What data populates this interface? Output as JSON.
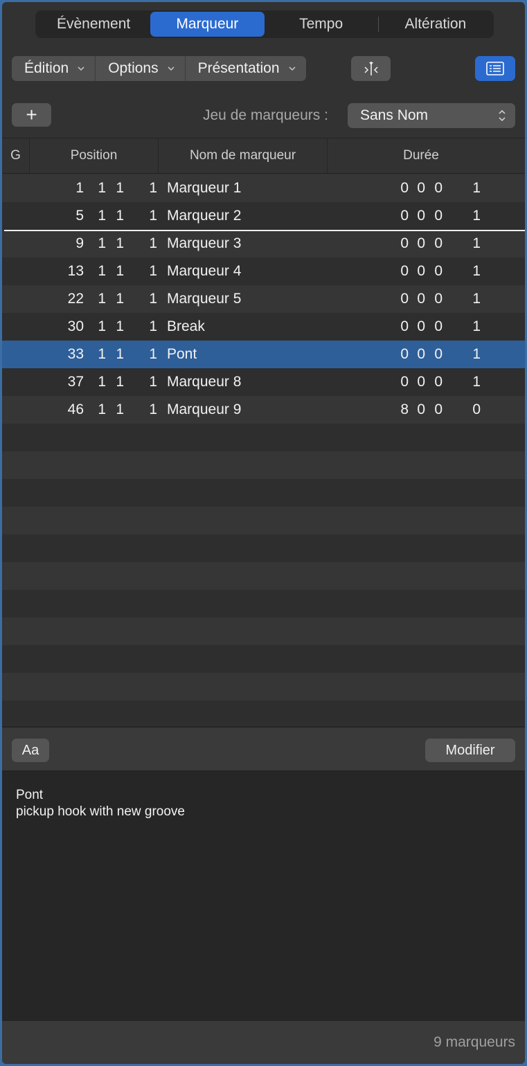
{
  "tabs": [
    {
      "label": "Évènement",
      "active": false
    },
    {
      "label": "Marqueur",
      "active": true
    },
    {
      "label": "Tempo",
      "active": false
    },
    {
      "label": "Altération",
      "active": false
    }
  ],
  "toolbar": {
    "menus": [
      "Édition",
      "Options",
      "Présentation"
    ],
    "snap_icon": "marker-snap-icon",
    "list_icon": "list-view-icon"
  },
  "add_button": "+",
  "marker_set": {
    "label": "Jeu de marqueurs :",
    "value": "Sans Nom"
  },
  "columns": {
    "g": "G",
    "position": "Position",
    "name": "Nom de marqueur",
    "duration": "Durée"
  },
  "markers": [
    {
      "pos": [
        "1",
        "1",
        "1",
        "1"
      ],
      "name": "Marqueur 1",
      "dur": [
        "0",
        "0",
        "0",
        "1"
      ]
    },
    {
      "pos": [
        "5",
        "1",
        "1",
        "1"
      ],
      "name": "Marqueur 2",
      "dur": [
        "0",
        "0",
        "0",
        "1"
      ]
    },
    {
      "pos": [
        "9",
        "1",
        "1",
        "1"
      ],
      "name": "Marqueur 3",
      "dur": [
        "0",
        "0",
        "0",
        "1"
      ]
    },
    {
      "pos": [
        "13",
        "1",
        "1",
        "1"
      ],
      "name": "Marqueur 4",
      "dur": [
        "0",
        "0",
        "0",
        "1"
      ]
    },
    {
      "pos": [
        "22",
        "1",
        "1",
        "1"
      ],
      "name": "Marqueur 5",
      "dur": [
        "0",
        "0",
        "0",
        "1"
      ]
    },
    {
      "pos": [
        "30",
        "1",
        "1",
        "1"
      ],
      "name": "Break",
      "dur": [
        "0",
        "0",
        "0",
        "1"
      ]
    },
    {
      "pos": [
        "33",
        "1",
        "1",
        "1"
      ],
      "name": "Pont",
      "dur": [
        "0",
        "0",
        "0",
        "1"
      ],
      "selected": true
    },
    {
      "pos": [
        "37",
        "1",
        "1",
        "1"
      ],
      "name": "Marqueur 8",
      "dur": [
        "0",
        "0",
        "0",
        "1"
      ]
    },
    {
      "pos": [
        "46",
        "1",
        "1",
        "1"
      ],
      "name": "Marqueur 9",
      "dur": [
        "8",
        "0",
        "0",
        "0"
      ]
    }
  ],
  "font_button": "Aa",
  "modify_button": "Modifier",
  "notes": {
    "line1": "Pont",
    "line2": "pickup hook with new groove"
  },
  "status": "9 marqueurs",
  "colors": {
    "accent": "#2b6bd0",
    "selection": "#2e5f99",
    "background": "#323232"
  }
}
